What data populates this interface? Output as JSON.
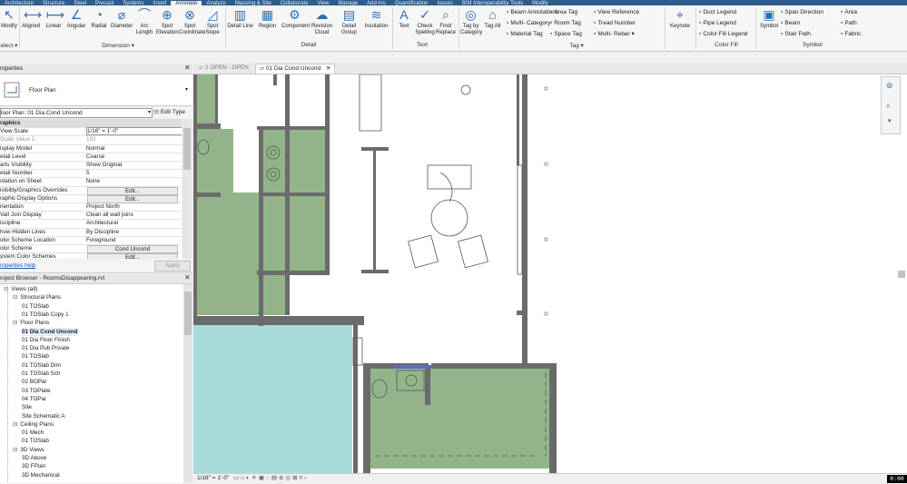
{
  "ribbon": {
    "tabs": [
      "Architecture",
      "Structure",
      "Steel",
      "Precast",
      "Systems",
      "Insert",
      "Annotate",
      "Analyze",
      "Massing & Site",
      "Collaborate",
      "View",
      "Manage",
      "Add-Ins",
      "Quantification",
      "Issues",
      "BIM Interoperability Tools",
      "Modify"
    ],
    "active_tab": "Annotate",
    "modify": {
      "label": "Modify",
      "select_label": "elect ▾"
    },
    "dimension": {
      "tools": [
        "Aligned",
        "Linear",
        "Angular",
        "Radial",
        "Diameter",
        "Arc Length",
        "Spot Elevation",
        "Spot Coordinate",
        "Spot Slope"
      ],
      "group_label": "Dimension ▾"
    },
    "detail": {
      "tools": [
        "Detail Line",
        "Region",
        "Component",
        "Revision Cloud",
        "Detail Group",
        "Insulation"
      ],
      "group_label": "Detail"
    },
    "text": {
      "tools": [
        "Text",
        "Check Spelling",
        "Find/ Replace"
      ],
      "group_label": "Text"
    },
    "tag": {
      "tools": [
        "Tag by Category",
        "Tag All"
      ],
      "small": [
        "Beam Annotations",
        "Multi- Category",
        "Material Tag",
        "Area Tag",
        "Room Tag",
        "Space Tag",
        "View Reference",
        "Tread Number",
        "Multi- Rebar ▾"
      ],
      "group_label": "Tag ▾"
    },
    "keynote": "Keynote",
    "color_fill": {
      "small": [
        "Duct Legend",
        "Pipe Legend",
        "Color Fill Legend"
      ],
      "group_label": "Color Fill"
    },
    "symbol": {
      "tools": [
        "Symbol"
      ],
      "small": [
        "Span Direction",
        "Beam",
        "Stair Path",
        "Area",
        "Path",
        "Fabric"
      ],
      "group_label": "Symbol"
    }
  },
  "properties": {
    "title": "roperties",
    "type_name": "Floor Plan",
    "instance_selector": "loor Plan: 01 Dia Cond Uncond",
    "edit_type_label": "Edit Type",
    "rows": [
      {
        "k": "raphics",
        "header": true
      },
      {
        "k": "View Scale",
        "v": "1/16\" = 1'-0\""
      },
      {
        "k": "Scale Value    1:",
        "v": "192",
        "muted": true
      },
      {
        "k": "isplay Model",
        "v": "Normal"
      },
      {
        "k": "etail Level",
        "v": "Coarse"
      },
      {
        "k": "arts Visibility",
        "v": "Show Original"
      },
      {
        "k": "etail Number",
        "v": "5"
      },
      {
        "k": "otation on Sheet",
        "v": "None"
      },
      {
        "k": "isibility/Graphics Overrides",
        "btn": "Edit..."
      },
      {
        "k": "raphic Display Options",
        "btn": "Edit..."
      },
      {
        "k": "rientation",
        "v": "Project North"
      },
      {
        "k": "Vall Join Display",
        "v": "Clean all wall joins"
      },
      {
        "k": "iscipline",
        "v": "Architectural"
      },
      {
        "k": "how Hidden Lines",
        "v": "By Discipline"
      },
      {
        "k": "olor Scheme Location",
        "v": "Foreground"
      },
      {
        "k": "olor Scheme",
        "btn": "Cond Uncond"
      },
      {
        "k": "ystem Color Schemes",
        "btn": "Edit..."
      }
    ],
    "help_link": "roperties help",
    "apply_label": "Apply"
  },
  "project_browser": {
    "title": "roject Browser - RoomsDisappearing.rvt",
    "items": [
      {
        "label": "Views (all)",
        "indent": 0,
        "tw": "⊟"
      },
      {
        "label": "Structural Plans",
        "indent": 1,
        "tw": "⊟"
      },
      {
        "label": "01 TOSlab",
        "indent": 2
      },
      {
        "label": "01 TOSlab Copy 1",
        "indent": 2
      },
      {
        "label": "Floor Plans",
        "indent": 1,
        "tw": "⊟"
      },
      {
        "label": "01 Dia Cond Uncond",
        "indent": 2,
        "selected": true
      },
      {
        "label": "01 Dia Floor Finish",
        "indent": 2
      },
      {
        "label": "01 Dia Pub Private",
        "indent": 2
      },
      {
        "label": "01 TOSlab",
        "indent": 2
      },
      {
        "label": "01 TOSlab Dim",
        "indent": 2
      },
      {
        "label": "01 TOSlab Sch",
        "indent": 2
      },
      {
        "label": "02 BOPar",
        "indent": 2
      },
      {
        "label": "03 TOPlate",
        "indent": 2
      },
      {
        "label": "04 TOPar",
        "indent": 2
      },
      {
        "label": "Site",
        "indent": 2
      },
      {
        "label": "Site Schematic A",
        "indent": 2
      },
      {
        "label": "Ceiling Plans",
        "indent": 1,
        "tw": "⊟"
      },
      {
        "label": "01 Mech",
        "indent": 2
      },
      {
        "label": "01 TOSlab",
        "indent": 2
      },
      {
        "label": "3D Views",
        "indent": 1,
        "tw": "⊟"
      },
      {
        "label": "3D Above",
        "indent": 2
      },
      {
        "label": "3D FPlan",
        "indent": 2
      },
      {
        "label": "3D Mechanical",
        "indent": 2
      }
    ]
  },
  "view_tabs": [
    {
      "label": "2 OPEN - OPEN",
      "active": false
    },
    {
      "label": "01 Dia Cond Uncond",
      "active": true
    }
  ],
  "status": {
    "scale": "1/16\" = 1'-0\""
  },
  "timer": "0:00",
  "colors": {
    "conditioned": "#93b48b",
    "unconditioned": "#a9dcd8",
    "wall": "#6b6b6b",
    "ribbon_blue": "#2d5d8f"
  }
}
